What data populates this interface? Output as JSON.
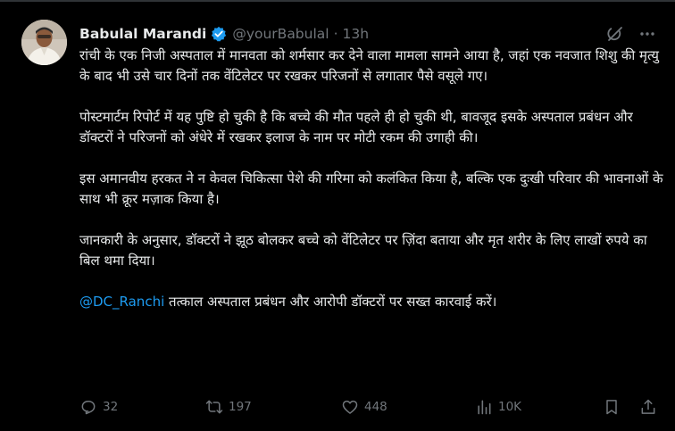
{
  "tweet": {
    "author_name": "Babulal Marandi",
    "handle": "@yourBabulal",
    "separator": "·",
    "time": "13h",
    "paragraphs": [
      "रांची के एक निजी अस्पताल में मानवता को शर्मसार कर देने वाला मामला सामने आया है, जहां एक नवजात शिशु की मृत्यु के बाद भी उसे चार दिनों तक वेंटिलेटर पर रखकर परिजनों से लगातार पैसे वसूले गए।",
      "पोस्टमार्टम रिपोर्ट में यह पुष्टि हो चुकी है कि बच्चे की मौत पहले ही हो चुकी थी, बावजूद इसके अस्पताल प्रबंधन और डॉक्टरों ने परिजनों को अंधेरे में रखकर इलाज के नाम पर मोटी रकम की उगाही की।",
      "इस अमानवीय हरकत ने न केवल चिकित्सा पेशे की गरिमा को कलंकित किया है, बल्कि एक दुःखी परिवार की भावनाओं के साथ भी क्रूर मज़ाक किया है।",
      "जानकारी के अनुसार, डॉक्टरों ने झूठ बोलकर बच्चे को वेंटिलेटर पर ज़िंदा बताया और मृत शरीर के लिए लाखों रुपये का बिल थमा दिया।"
    ],
    "last_paragraph": {
      "mention": "@DC_Ranchi",
      "text": " तत्काल अस्पताल प्रबंधन और आरोपी डॉक्टरों पर सख्त कारवाई करें।"
    },
    "actions": {
      "reply_count": "32",
      "repost_count": "197",
      "like_count": "448",
      "view_count": "10K"
    }
  },
  "colors": {
    "background": "#000000",
    "text": "#e7e9ea",
    "muted": "#71767b",
    "accent": "#1d9bf0"
  },
  "icons": [
    "verified-badge-icon",
    "grok-icon",
    "more-icon",
    "reply-icon",
    "repost-icon",
    "like-icon",
    "views-icon",
    "bookmark-icon",
    "share-icon"
  ]
}
